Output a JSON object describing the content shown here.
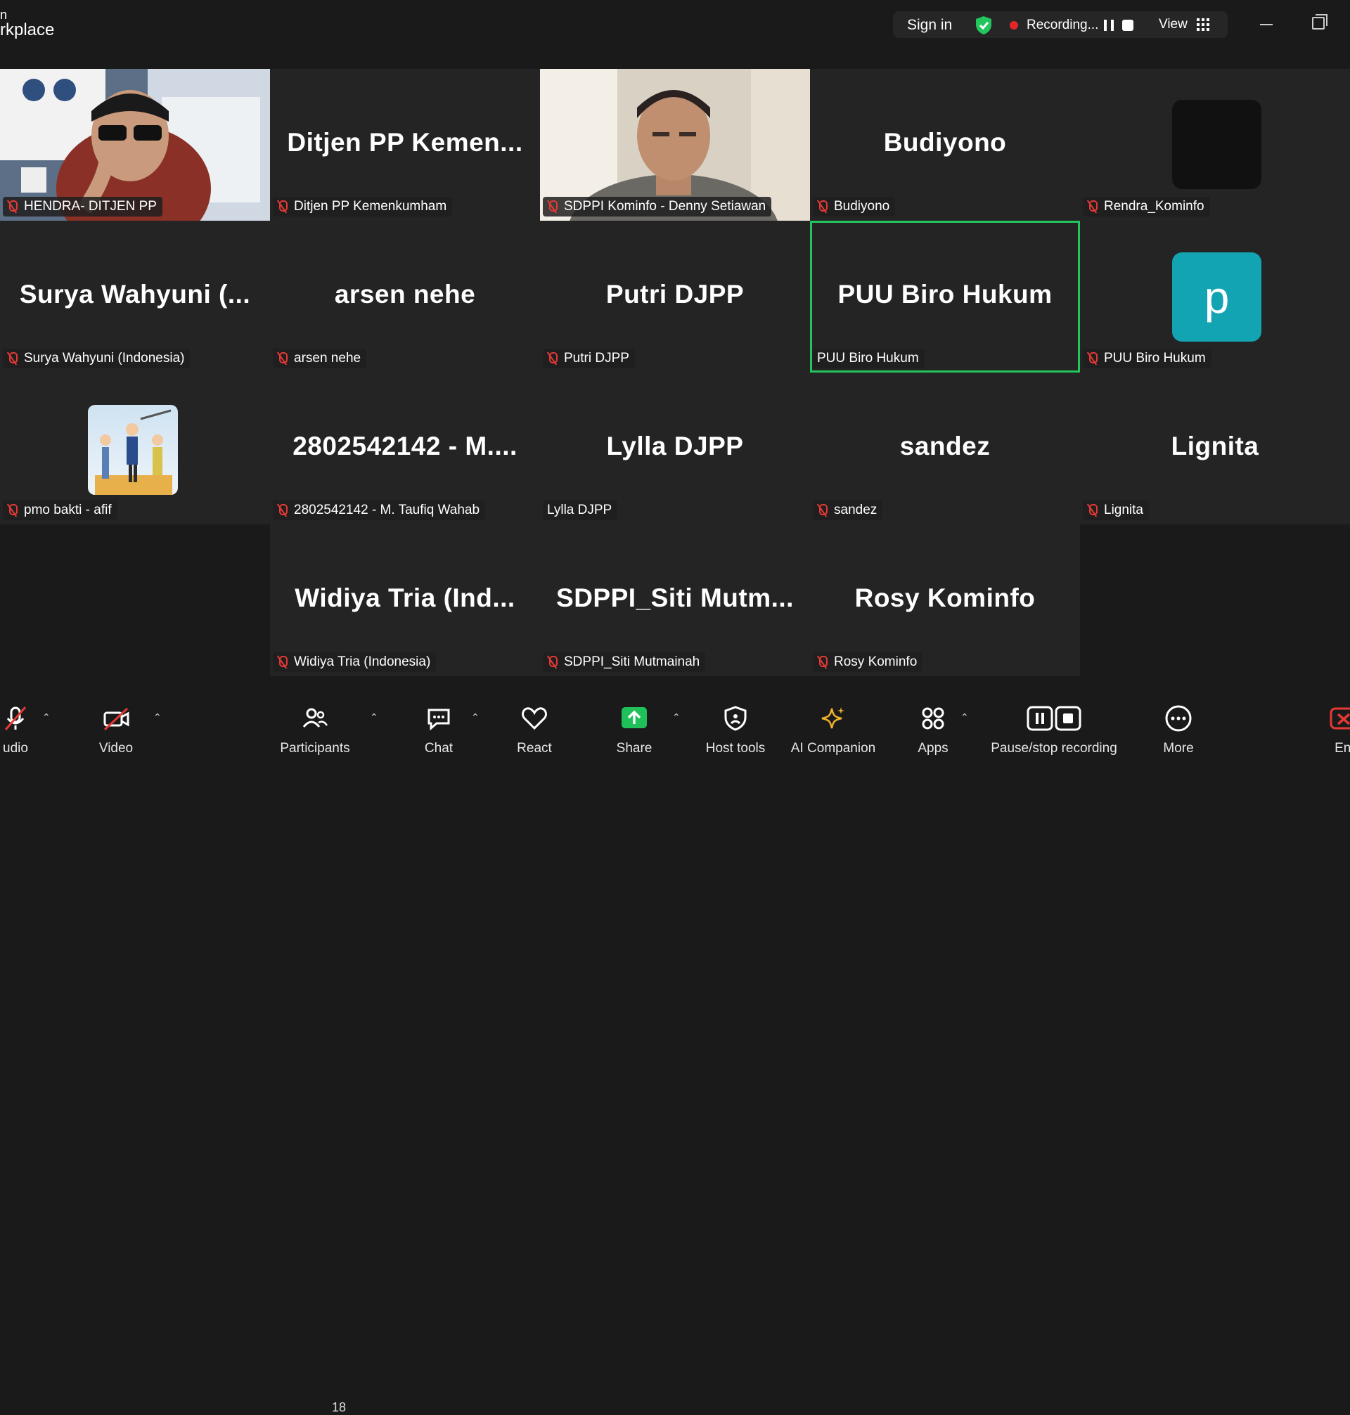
{
  "app": {
    "title_line1": "n",
    "title_line2": "rkplace"
  },
  "topbar": {
    "sign_in": "Sign in",
    "recording": "Recording...",
    "view": "View"
  },
  "tiles": [
    {
      "name": "",
      "label": "HENDRA- DITJEN PP",
      "muted": true
    },
    {
      "name": "Ditjen PP Kemen...",
      "label": "Ditjen PP Kemenkumham",
      "muted": true
    },
    {
      "name": "",
      "label": "SDPPI Kominfo - Denny Setiawan",
      "muted": true
    },
    {
      "name": "Budiyono",
      "label": "Budiyono",
      "muted": true
    },
    {
      "name": "",
      "label": "Rendra_Kominfo",
      "muted": true
    },
    {
      "name": "Surya Wahyuni (...",
      "label": "Surya Wahyuni (Indonesia)",
      "muted": true
    },
    {
      "name": "arsen nehe",
      "label": "arsen nehe",
      "muted": true
    },
    {
      "name": "Putri DJPP",
      "label": "Putri DJPP",
      "muted": true
    },
    {
      "name": "PUU Biro Hukum",
      "label": "PUU Biro Hukum",
      "muted": false
    },
    {
      "name": "",
      "label": "PUU Biro Hukum",
      "muted": true,
      "avatar_letter": "p"
    },
    {
      "name": "",
      "label": "pmo bakti - afif",
      "muted": true
    },
    {
      "name": "2802542142 - M....",
      "label": "2802542142 - M. Taufiq Wahab",
      "muted": true
    },
    {
      "name": "Lylla DJPP",
      "label": "Lylla DJPP",
      "muted": false
    },
    {
      "name": "sandez",
      "label": "sandez",
      "muted": true
    },
    {
      "name": "Lignita",
      "label": "Lignita",
      "muted": true
    },
    {
      "name": "Widiya Tria (Ind...",
      "label": "Widiya Tria (Indonesia)",
      "muted": true
    },
    {
      "name": "SDPPI_Siti Mutm...",
      "label": "SDPPI_Siti Mutmainah",
      "muted": true
    },
    {
      "name": "Rosy Kominfo",
      "label": "Rosy Kominfo",
      "muted": true
    }
  ],
  "toolbar": {
    "audio": "udio",
    "video": "Video",
    "participants": "Participants",
    "participant_count": "18",
    "chat": "Chat",
    "react": "React",
    "share": "Share",
    "host_tools": "Host tools",
    "ai_companion": "AI Companion",
    "apps": "Apps",
    "pause_stop": "Pause/stop recording",
    "more": "More",
    "end": "End"
  },
  "colors": {
    "accent_green": "#22c55e",
    "share_green": "#1fbf5a",
    "avatar_teal": "#13a4b4",
    "mute_red": "#e53935"
  }
}
